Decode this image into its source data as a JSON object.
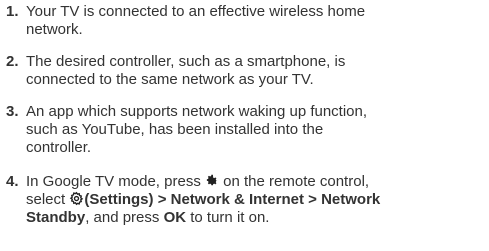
{
  "items": [
    {
      "number": "1.",
      "lines": [
        "Your TV is connected to an effective wireless home",
        "network."
      ]
    },
    {
      "number": "2.",
      "lines": [
        "The desired controller, such as a smartphone, is",
        "connected to the same network as your TV."
      ]
    },
    {
      "number": "3.",
      "lines": [
        "An app which supports network waking up function,",
        "such as YouTube, has been installed into the",
        "controller."
      ]
    },
    {
      "number": "4.",
      "line1_a": "In Google TV mode, press ",
      "line1_b": " on the remote control,",
      "line2_a": "select ",
      "line2_b": "(Settings) > Network & Internet > Network",
      "line3_a": "Standby",
      "line3_b": ", and press ",
      "line3_c": "OK",
      "line3_d": " to turn it on.",
      "icons": [
        "gear-icon",
        "settings-icon"
      ]
    }
  ]
}
